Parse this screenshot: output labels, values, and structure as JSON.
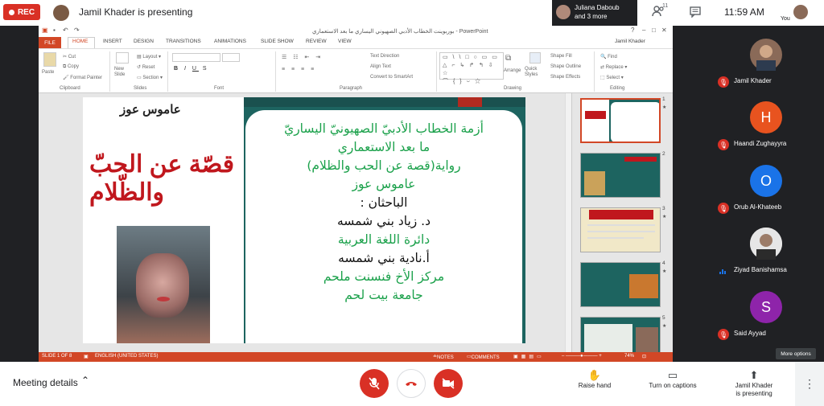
{
  "meet": {
    "rec_label": "REC",
    "presenting_banner": "Jamil Khader is presenting",
    "others_chip": {
      "line1": "Juliana Daboub",
      "line2": "and 3 more"
    },
    "participant_count": "11",
    "clock": "11:59 AM",
    "you_label": "You",
    "more_options_tooltip": "More options",
    "participants": [
      {
        "name": "Jamil Khader",
        "initial": "",
        "avatar_color": "#8a6a58",
        "mic": "off"
      },
      {
        "name": "Haandi Zughayyra",
        "initial": "H",
        "avatar_color": "#e8531f",
        "mic": "off"
      },
      {
        "name": "Orub Al-Khateeb",
        "initial": "O",
        "avatar_color": "#1a73e8",
        "mic": "off"
      },
      {
        "name": "Ziyad Banishamsa",
        "initial": "",
        "avatar_color": "#ffffff",
        "mic": "on"
      },
      {
        "name": "Said Ayyad",
        "initial": "S",
        "avatar_color": "#8e24aa",
        "mic": "off"
      }
    ],
    "bottom": {
      "meeting_details": "Meeting details",
      "raise_hand": "Raise hand",
      "captions": "Turn on captions",
      "presenting_line1": "Jamil Khader",
      "presenting_line2": "is presenting"
    }
  },
  "ppt": {
    "window_title": "بوربوينت الخطاب الأدبي الصهيوني اليساري ما بعد الاستعماري - PowerPoint",
    "user": "Jamil Khader",
    "tabs": [
      "FILE",
      "HOME",
      "INSERT",
      "DESIGN",
      "TRANSITIONS",
      "ANIMATIONS",
      "SLIDE SHOW",
      "REVIEW",
      "VIEW"
    ],
    "ribbon": {
      "paste": "Paste",
      "cut": "Cut",
      "copy": "Copy",
      "format_painter": "Format Painter",
      "clipboard": "Clipboard",
      "new_slide": "New Slide",
      "layout": "Layout",
      "reset": "Reset",
      "section": "Section",
      "slides": "Slides",
      "font": "Font",
      "text_direction": "Text Direction",
      "align_text": "Align Text",
      "convert_smartart": "Convert to SmartArt",
      "paragraph": "Paragraph",
      "arrange": "Arrange",
      "quick_styles": "Quick Styles",
      "shape_fill": "Shape Fill",
      "shape_outline": "Shape Outline",
      "shape_effects": "Shape Effects",
      "drawing": "Drawing",
      "find": "Find",
      "replace": "Replace",
      "select": "Select",
      "editing": "Editing"
    },
    "slide": {
      "cover_author": "عاموس عوز",
      "cover_title": "قصّة عن الحبّ والظّلام",
      "lines": [
        {
          "text": "أزمة الخطاب الأدبيّ الصهيونيّ اليساريّ",
          "color": "green"
        },
        {
          "text": "ما بعد الاستعماري",
          "color": "green"
        },
        {
          "text": "رواية(قصة عن  الحب والظلام)",
          "color": "green"
        },
        {
          "text": "عاموس عوز",
          "color": "green"
        },
        {
          "text": "الباحثان :",
          "color": "black"
        },
        {
          "text": "د. زياد بني شمسه",
          "color": "black"
        },
        {
          "text": "دائرة اللغة العربية",
          "color": "green"
        },
        {
          "text": "أ.نادية بني شمسه",
          "color": "black"
        },
        {
          "text": "مركز الأخ فنسنت ملحم",
          "color": "green"
        },
        {
          "text": "جامعة بيت لحم",
          "color": "green"
        }
      ]
    },
    "thumb_numbers": [
      "1",
      "2",
      "3",
      "4",
      "5"
    ],
    "thumb_star": "★",
    "status": {
      "slide_of": "SLIDE 1 OF 8",
      "language": "ENGLISH (UNITED STATES)",
      "notes": "NOTES",
      "comments": "COMMENTS",
      "zoom": "74%"
    }
  }
}
